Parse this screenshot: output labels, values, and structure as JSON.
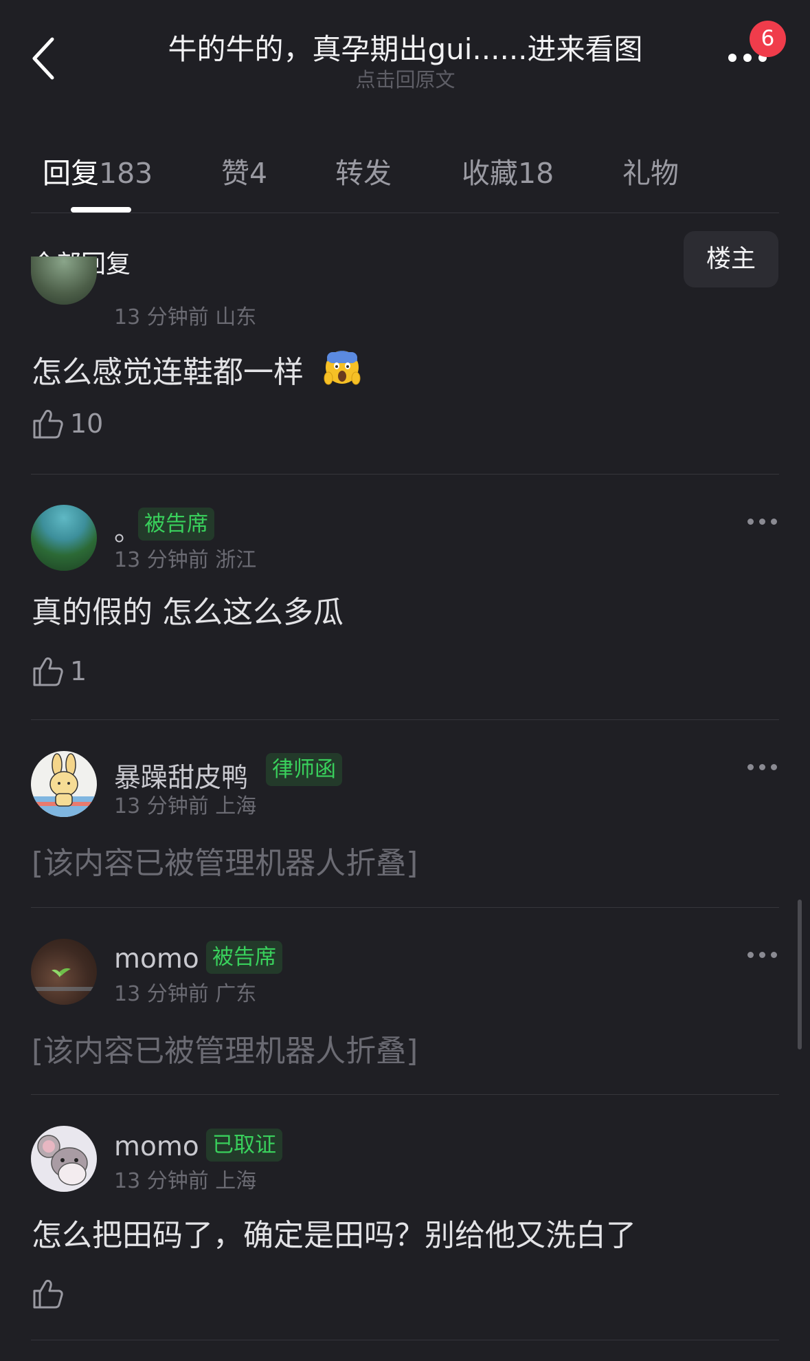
{
  "header": {
    "title": "牛的牛的，真孕期出gui......进来看图",
    "subtitle": "点击回原文",
    "notification_count": "6"
  },
  "tabs": [
    {
      "label": "回复",
      "count": "183",
      "active": true
    },
    {
      "label": "赞",
      "count": "4",
      "active": false
    },
    {
      "label": "转发",
      "count": "",
      "active": false
    },
    {
      "label": "收藏",
      "count": "18",
      "active": false
    },
    {
      "label": "礼物",
      "count": "",
      "active": false
    }
  ],
  "section": {
    "title": "全部回复",
    "filter_button": "楼主"
  },
  "comments": [
    {
      "username": "",
      "tag": "",
      "meta": "13 分钟前 山东",
      "text": "怎么感觉连鞋都一样",
      "emoji": "scream-emoji",
      "likes": "10",
      "folded": false
    },
    {
      "username": "。",
      "tag": "被告席",
      "meta": "13 分钟前 浙江",
      "text": "真的假的 怎么这么多瓜",
      "likes": "1",
      "folded": false
    },
    {
      "username": "暴躁甜皮鸭",
      "tag": "律师函",
      "meta": "13 分钟前 上海",
      "text": "[该内容已被管理机器人折叠]",
      "likes": "",
      "folded": true
    },
    {
      "username": "momo",
      "tag": "被告席",
      "meta": "13 分钟前 广东",
      "text": "[该内容已被管理机器人折叠]",
      "likes": "",
      "folded": true
    },
    {
      "username": "momo",
      "tag": "已取证",
      "meta": "13 分钟前 上海",
      "text": "怎么把田码了，确定是田吗？别给他又洗白了",
      "likes": "",
      "folded": false
    }
  ],
  "icons": {
    "back": "chevron-left-icon",
    "more": "more-dots-icon",
    "like": "thumbs-up-icon"
  },
  "colors": {
    "background": "#1f1f24",
    "tag_text": "#39d05c",
    "tag_bg": "#233a2a",
    "badge": "#f03c4b"
  }
}
